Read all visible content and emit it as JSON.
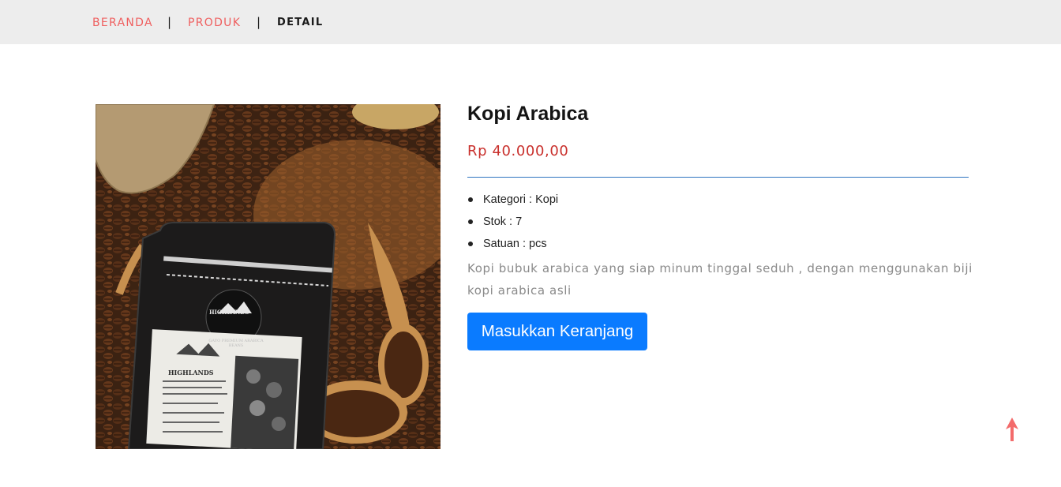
{
  "breadcrumb": {
    "items": [
      {
        "label": "BERANDA"
      },
      {
        "label": "PRODUK"
      },
      {
        "label": "DETAIL"
      }
    ],
    "separator": "|"
  },
  "product": {
    "image_icon": "coffee-package-photo",
    "name": "Kopi Arabica",
    "price": "Rp 40.000,00",
    "specs": [
      {
        "text": "Kategori : Kopi"
      },
      {
        "text": "Stok : 7"
      },
      {
        "text": "Satuan : pcs"
      }
    ],
    "description": "Kopi bubuk arabica yang siap minum tinggal seduh , dengan menggunakan biji kopi arabica asli",
    "cart_button_label": "Masukkan Keranjang"
  },
  "package_text": {
    "brand": "HIGHLANDS",
    "product_line": "GAYO PREMIUM ARABICA BEANS"
  },
  "colors": {
    "accent": "#ef5f5f",
    "price": "#c9302c",
    "button": "#0a7bff",
    "divider": "#2f74c0"
  },
  "scroll_top_icon": "arrow-up-icon"
}
